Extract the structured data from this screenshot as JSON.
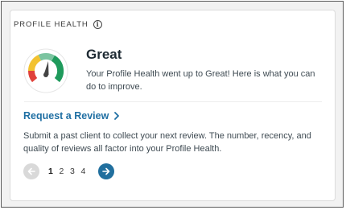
{
  "header": {
    "label": "PROFILE HEALTH",
    "info_icon": "info-icon"
  },
  "status": {
    "title": "Great",
    "description": "Your Profile Health went up to Great! Here is what you can do to improve.",
    "gauge_icon": "gauge-icon",
    "gauge_colors": {
      "red": "#e0413a",
      "yellow": "#f2c230",
      "light_green": "#7bc4a0",
      "green": "#1f9a5c",
      "needle": "#444444"
    }
  },
  "action": {
    "link_label": "Request a Review",
    "description": "Submit a past client to collect your next review. The number, recency, and quality of reviews all factor into your Profile Health."
  },
  "pagination": {
    "pages": [
      "1",
      "2",
      "3",
      "4"
    ],
    "current": "1",
    "prev_icon": "arrow-left-icon",
    "next_icon": "arrow-right-icon"
  },
  "colors": {
    "link": "#1f6fa3",
    "next_button": "#216f9e",
    "prev_button_disabled": "#d9d9d9"
  }
}
